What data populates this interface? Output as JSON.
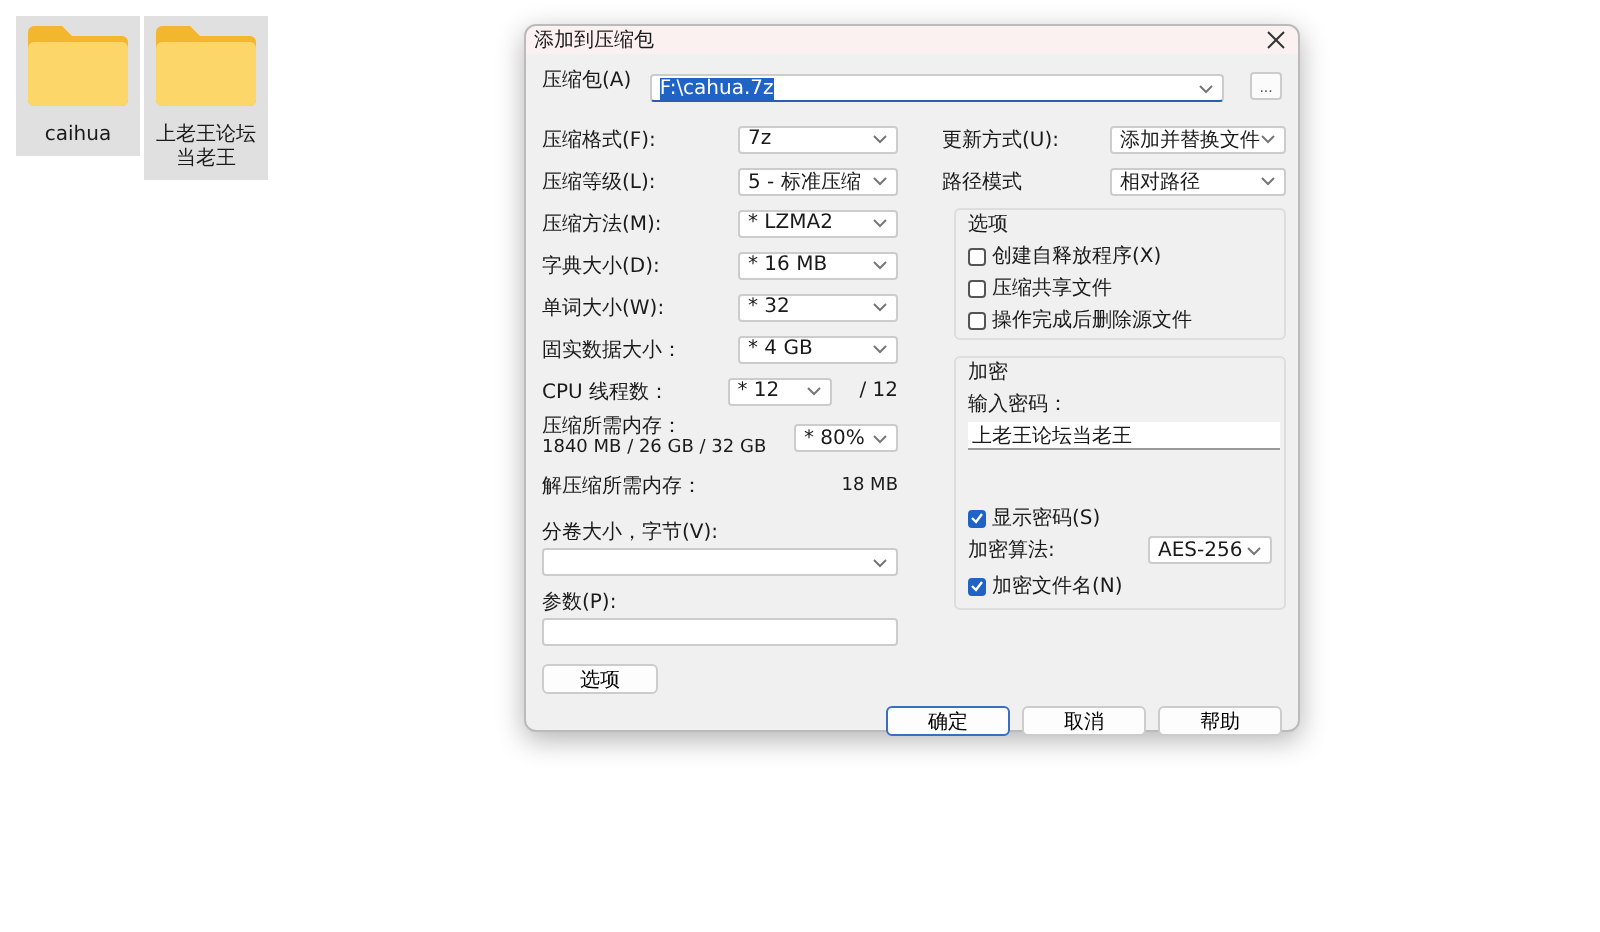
{
  "desktop_icons": [
    {
      "label": "caihua",
      "selected": true
    },
    {
      "label": "上老王论坛当老王",
      "selected": true
    }
  ],
  "dialog": {
    "title": "添加到压缩包",
    "archive": {
      "label": "压缩包(A)",
      "value": "F:\\cahua.7z",
      "text_selected": true,
      "browse": "..."
    },
    "left_rows": [
      {
        "kind": "select",
        "label": "压缩格式(F):",
        "value": "7z"
      },
      {
        "kind": "select",
        "label": "压缩等级(L):",
        "value": "5 - 标准压缩"
      },
      {
        "kind": "select",
        "label": "压缩方法(M):",
        "value": "* LZMA2"
      },
      {
        "kind": "select",
        "label": "字典大小(D):",
        "value": "* 16 MB"
      },
      {
        "kind": "select",
        "label": "单词大小(W):",
        "value": "* 32"
      },
      {
        "kind": "select",
        "label": "固实数据大小：",
        "value": "* 4 GB"
      },
      {
        "kind": "short_select",
        "label": "CPU 线程数：",
        "value": "* 12",
        "suffix": "/ 12"
      },
      {
        "kind": "memory",
        "label": "压缩所需内存：",
        "detail": "1840 MB / 26 GB / 32 GB",
        "value": "* 80%"
      },
      {
        "kind": "info",
        "label": "解压缩所需内存：",
        "value": "18 MB"
      }
    ],
    "split": {
      "label": "分卷大小，字节(V):"
    },
    "params": {
      "label": "参数(P):"
    },
    "options_button": "选项",
    "right_rows": [
      {
        "label": "更新方式(U):",
        "value": "添加并替换文件"
      },
      {
        "label": "路径模式",
        "value": "相对路径"
      }
    ],
    "options_group": {
      "title": "选项",
      "checkboxes": [
        {
          "label": "创建自释放程序(X)",
          "checked": false
        },
        {
          "label": "压缩共享文件",
          "checked": false
        },
        {
          "label": "操作完成后删除源文件",
          "checked": false
        }
      ]
    },
    "encryption": {
      "title": "加密",
      "password_label": "输入密码：",
      "password": "上老王论坛当老王",
      "show_password": {
        "label": "显示密码(S)",
        "checked": true
      },
      "method": {
        "label": "加密算法:",
        "value": "AES-256"
      },
      "encrypt_names": {
        "label": "加密文件名(N)",
        "checked": true
      }
    },
    "buttons": [
      {
        "label": "确定",
        "default": true
      },
      {
        "label": "取消",
        "default": false
      },
      {
        "label": "帮助",
        "default": false
      }
    ]
  }
}
